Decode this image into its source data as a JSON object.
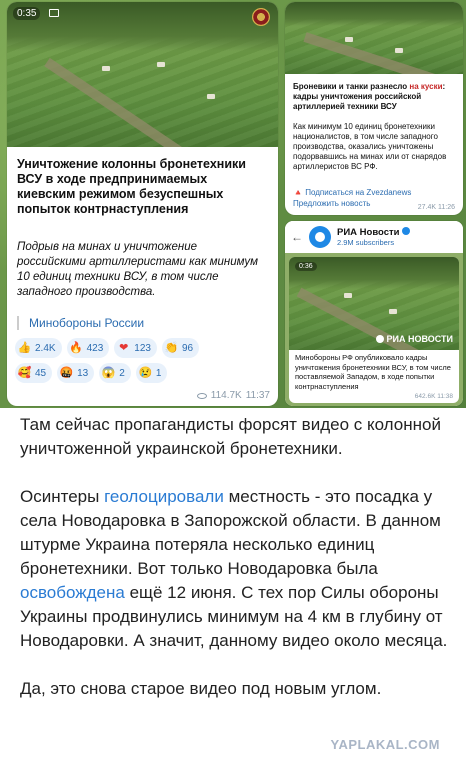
{
  "card_main": {
    "timecode": "0:35",
    "title": "Уничтожение колонны бронетехники ВСУ в ходе предпринимаемых киевским режимом безуспешных попыток контрнаступления",
    "lead": "Подрыв на минах и уничтожение российскими артиллеристами как минимум 10 единиц техники ВСУ, в том числе западного производства.",
    "source": "Минобороны России",
    "reactions_row1": [
      {
        "emoji": "👍",
        "count": "2.4K"
      },
      {
        "emoji": "🔥",
        "count": "423"
      },
      {
        "emoji": "❤",
        "count": "123"
      },
      {
        "emoji": "👏",
        "count": "96"
      }
    ],
    "reactions_row2": [
      {
        "emoji": "🥰",
        "count": "45"
      },
      {
        "emoji": "🤬",
        "count": "13"
      },
      {
        "emoji": "😱",
        "count": "2"
      },
      {
        "emoji": "😢",
        "count": "1"
      }
    ],
    "views": "114.7K",
    "time": "11:37"
  },
  "card_zvezda": {
    "headline_part1": "Броневики и танки разнесло",
    "headline_part2": "на куски",
    "headline_part3": ": кадры уничтожения российской артиллерией техники ВСУ",
    "body": "Как минимум 10 единиц бронетехники националистов, в том числе западного производства, оказались уничтожены подорвавшись на минах или от снарядов артиллеристов ВС РФ.",
    "subscribe": "Подписаться на Zvezdanews",
    "suggest": "Предложить новость",
    "meta": "27.4K 11:26"
  },
  "card_ria": {
    "channel": "РИА Новости",
    "subscribers": "2.9M subscribers",
    "timecode": "0:36",
    "watermark": "РИА НОВОСТИ",
    "caption": "Минобороны РФ опубликовало кадры уничтожения бронетехники ВСУ, в том числе поставляемой Западом, в ходе попытки контрнаступления",
    "meta": "642.6K 11:38"
  },
  "comment": {
    "p1": "Там сейчас пропагандисты форсят видео с колонной уничтоженной украинской бронетехники.",
    "p2_a": "Осинтеры ",
    "p2_link1": "геолоцировали",
    "p2_b": " местность - это посадка у села Новодаровка в Запорожской области. В данном штурме Украина потеряла несколько единиц бронетехники. Вот только Новодаровка была ",
    "p2_link2": "освобождена",
    "p2_c": " ещё 12 июня. С тех пор Силы обороны Украины продвинулись минимум на 4 км в глубину от Новодаровки. А значит, данному видео около месяца.",
    "p3": "Да, это снова старое видео под новым углом."
  },
  "watermark": "YAPLAKAL.COM",
  "colors": {
    "link": "#2a7bd3",
    "telegram_blue": "#2b6cb0",
    "reaction_bg": "#e8f1fb"
  }
}
